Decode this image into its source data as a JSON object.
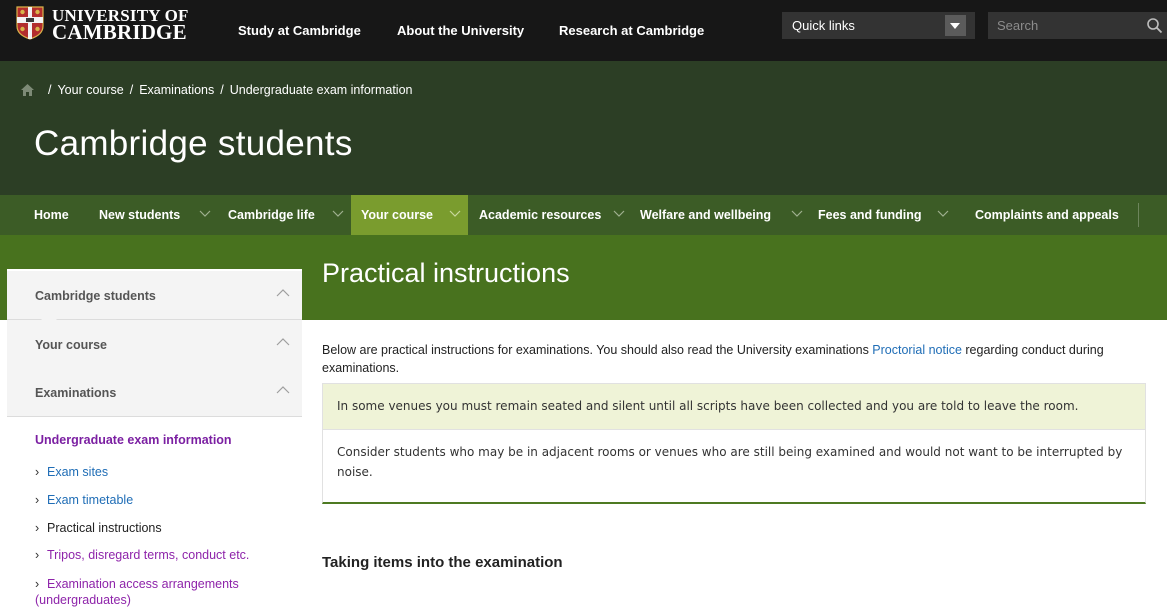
{
  "header": {
    "logo_line1": "UNIVERSITY OF",
    "logo_line2": "CAMBRIDGE",
    "nav": [
      "Study at Cambridge",
      "About the University",
      "Research at Cambridge"
    ],
    "quick_links": "Quick links",
    "search_placeholder": "Search"
  },
  "breadcrumb": [
    "Your course",
    "Examinations",
    "Undergraduate exam information"
  ],
  "site_title": "Cambridge students",
  "main_nav": [
    {
      "label": "Home"
    },
    {
      "label": "New students"
    },
    {
      "label": "Cambridge life"
    },
    {
      "label": "Your course",
      "active": true
    },
    {
      "label": "Academic resources"
    },
    {
      "label": "Welfare and wellbeing"
    },
    {
      "label": "Fees and funding"
    },
    {
      "label": "Complaints and appeals"
    }
  ],
  "page_title": "Practical instructions",
  "sidebar": {
    "sections": [
      "Cambridge students",
      "Your course",
      "Examinations"
    ],
    "current": "Undergraduate exam information",
    "links": [
      {
        "label": "Exam sites"
      },
      {
        "label": "Exam timetable"
      },
      {
        "label": "Practical instructions"
      },
      {
        "label": "Tripos, disregard terms, conduct etc."
      },
      {
        "label": "Examination access arrangements (undergraduates)"
      }
    ]
  },
  "content": {
    "intro_before": "Below are practical instructions for examinations. You should also read the University examinations ",
    "intro_link": "Proctorial notice",
    "intro_after": " regarding conduct during examinations.",
    "notice_highlight": "In some venues you must remain seated and silent until all scripts have been collected and you are told to leave the room.",
    "notice_body": "Consider students who may be in adjacent rooms or venues who are still being examined and would not want to be interrupted by noise.",
    "section_heading": "Taking items into the examination"
  },
  "colors": {
    "topbar": "#171717",
    "header_band": "#2c3e25",
    "main_nav": "#3c5c26",
    "nav_active": "#7a9c2e",
    "title_band": "#48721e",
    "link_blue": "#1f6db6",
    "link_visited": "#8e24aa"
  }
}
